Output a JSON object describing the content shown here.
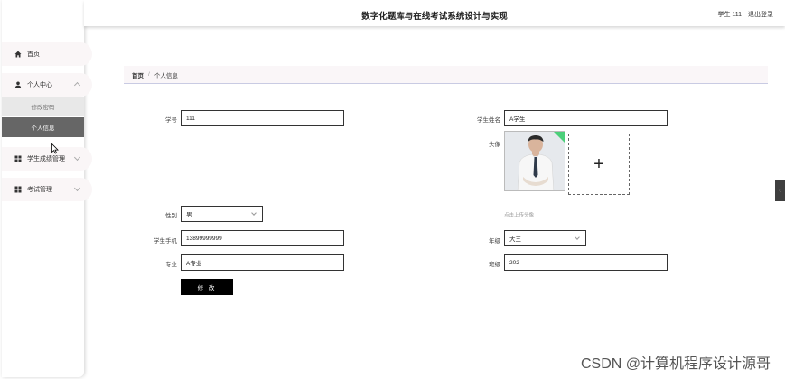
{
  "header": {
    "title": "数字化题库与在线考试系统设计与实现",
    "user_label": "学生 111",
    "logout": "退出登录"
  },
  "sidebar": {
    "home": "首页",
    "personal_center": "个人中心",
    "change_password": "修改密码",
    "personal_info": "个人信息",
    "grades": "学生成绩管理",
    "exams": "考试管理"
  },
  "breadcrumb": {
    "home": "首页",
    "separator": "/",
    "current": "个人信息"
  },
  "form": {
    "student_id_label": "学号",
    "student_id_value": "111",
    "student_name_label": "学生姓名",
    "student_name_value": "A学生",
    "avatar_label": "头像",
    "upload_plus": "+",
    "upload_hint": "点击上传头像",
    "gender_label": "性别",
    "gender_value": "男",
    "phone_label": "学生手机",
    "phone_value": "13899999999",
    "grade_label": "年级",
    "grade_value": "大三",
    "major_label": "专业",
    "major_value": "A专业",
    "class_label": "班级",
    "class_value": "202",
    "submit": "修 改"
  },
  "side_tab": "‹",
  "watermark": "CSDN @计算机程序设计源哥",
  "colors": {
    "accent_green": "#4cd07a",
    "active_menu_bg": "#666666",
    "button_bg": "#000000"
  }
}
